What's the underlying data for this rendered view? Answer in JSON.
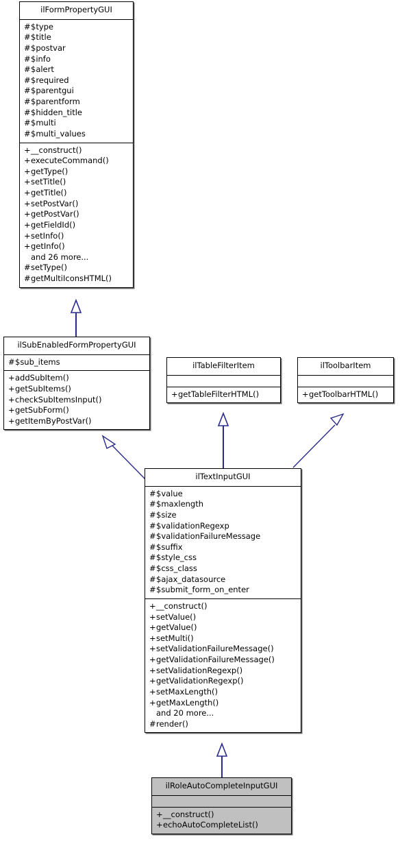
{
  "diagram": {
    "title": "ilRoleAutoCompleteInputGUI inheritance diagram",
    "type": "uml-class-inheritance",
    "accent_color": "#2a2a8c",
    "highlight_fill": "#c0c0c0",
    "box_fill": "#ffffff",
    "border_color": "#000000"
  },
  "classes": {
    "ilformpropertygui": {
      "name": "ilFormPropertyGUI",
      "highlighted": false,
      "attributes": [
        {
          "visibility": "#",
          "label": "$type"
        },
        {
          "visibility": "#",
          "label": "$title"
        },
        {
          "visibility": "#",
          "label": "$postvar"
        },
        {
          "visibility": "#",
          "label": "$info"
        },
        {
          "visibility": "#",
          "label": "$alert"
        },
        {
          "visibility": "#",
          "label": "$required"
        },
        {
          "visibility": "#",
          "label": "$parentgui"
        },
        {
          "visibility": "#",
          "label": "$parentform"
        },
        {
          "visibility": "#",
          "label": "$hidden_title"
        },
        {
          "visibility": "#",
          "label": "$multi"
        },
        {
          "visibility": "#",
          "label": "$multi_values"
        }
      ],
      "operations": [
        {
          "visibility": "+",
          "label": "__construct()"
        },
        {
          "visibility": "+",
          "label": "executeCommand()"
        },
        {
          "visibility": "+",
          "label": "getType()"
        },
        {
          "visibility": "+",
          "label": "setTitle()"
        },
        {
          "visibility": "+",
          "label": "getTitle()"
        },
        {
          "visibility": "+",
          "label": "setPostVar()"
        },
        {
          "visibility": "+",
          "label": "getPostVar()"
        },
        {
          "visibility": "+",
          "label": "getFieldId()"
        },
        {
          "visibility": "+",
          "label": "setInfo()"
        },
        {
          "visibility": "+",
          "label": "getInfo()"
        },
        {
          "visibility": "",
          "label": "and 26 more..."
        },
        {
          "visibility": "#",
          "label": "setType()"
        },
        {
          "visibility": "#",
          "label": "getMultiIconsHTML()"
        }
      ]
    },
    "ilsubenabled": {
      "name": "ilSubEnabledFormPropertyGUI",
      "highlighted": false,
      "attributes": [
        {
          "visibility": "#",
          "label": "$sub_items"
        }
      ],
      "operations": [
        {
          "visibility": "+",
          "label": "addSubItem()"
        },
        {
          "visibility": "+",
          "label": "getSubItems()"
        },
        {
          "visibility": "+",
          "label": "checkSubItemsInput()"
        },
        {
          "visibility": "+",
          "label": "getSubForm()"
        },
        {
          "visibility": "+",
          "label": "getItemByPostVar()"
        }
      ]
    },
    "iltablefilteritem": {
      "name": "ilTableFilterItem",
      "highlighted": false,
      "attributes": [],
      "operations": [
        {
          "visibility": "+",
          "label": "getTableFilterHTML()"
        }
      ]
    },
    "iltoolbaritem": {
      "name": "ilToolbarItem",
      "highlighted": false,
      "attributes": [],
      "operations": [
        {
          "visibility": "+",
          "label": "getToolbarHTML()"
        }
      ]
    },
    "iltextinputgui": {
      "name": "ilTextInputGUI",
      "highlighted": false,
      "attributes": [
        {
          "visibility": "#",
          "label": "$value"
        },
        {
          "visibility": "#",
          "label": "$maxlength"
        },
        {
          "visibility": "#",
          "label": "$size"
        },
        {
          "visibility": "#",
          "label": "$validationRegexp"
        },
        {
          "visibility": "#",
          "label": "$validationFailureMessage"
        },
        {
          "visibility": "#",
          "label": "$suffix"
        },
        {
          "visibility": "#",
          "label": "$style_css"
        },
        {
          "visibility": "#",
          "label": "$css_class"
        },
        {
          "visibility": "#",
          "label": "$ajax_datasource"
        },
        {
          "visibility": "#",
          "label": "$submit_form_on_enter"
        }
      ],
      "operations": [
        {
          "visibility": "+",
          "label": "__construct()"
        },
        {
          "visibility": "+",
          "label": "setValue()"
        },
        {
          "visibility": "+",
          "label": "getValue()"
        },
        {
          "visibility": "+",
          "label": "setMulti()"
        },
        {
          "visibility": "+",
          "label": "setValidationFailureMessage()"
        },
        {
          "visibility": "+",
          "label": "getValidationFailureMessage()"
        },
        {
          "visibility": "+",
          "label": "setValidationRegexp()"
        },
        {
          "visibility": "+",
          "label": "getValidationRegexp()"
        },
        {
          "visibility": "+",
          "label": "setMaxLength()"
        },
        {
          "visibility": "+",
          "label": "getMaxLength()"
        },
        {
          "visibility": "",
          "label": "and 20 more..."
        },
        {
          "visibility": "#",
          "label": "render()"
        }
      ]
    },
    "ilroleautocomplete": {
      "name": "ilRoleAutoCompleteInputGUI",
      "highlighted": true,
      "attributes": [],
      "operations": [
        {
          "visibility": "+",
          "label": "__construct()"
        },
        {
          "visibility": "+",
          "label": "echoAutoCompleteList()"
        }
      ]
    }
  },
  "relations": [
    {
      "from": "ilsubenabled",
      "to": "ilformpropertygui",
      "type": "generalization"
    },
    {
      "from": "iltextinputgui",
      "to": "ilsubenabled",
      "type": "generalization"
    },
    {
      "from": "iltextinputgui",
      "to": "iltablefilteritem",
      "type": "generalization"
    },
    {
      "from": "iltextinputgui",
      "to": "iltoolbaritem",
      "type": "generalization"
    },
    {
      "from": "ilroleautocomplete",
      "to": "iltextinputgui",
      "type": "generalization"
    }
  ]
}
